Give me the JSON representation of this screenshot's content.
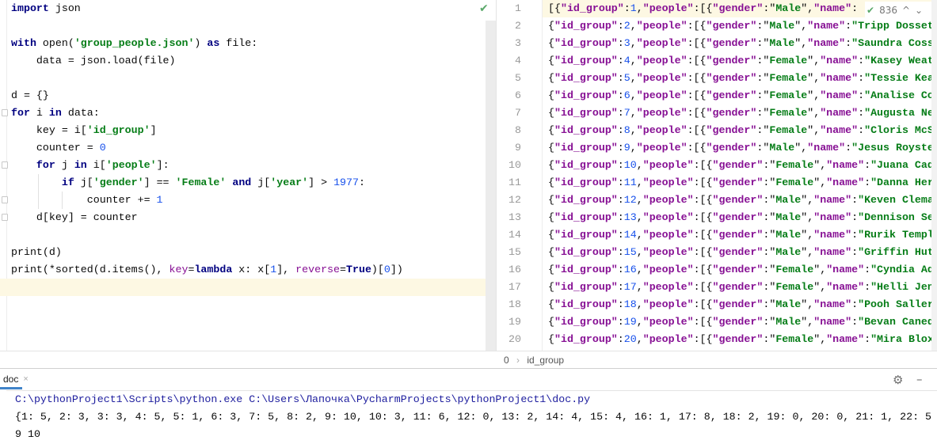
{
  "left_editor": {
    "status": "✔",
    "lines": [
      [
        [
          "import",
          "kw"
        ],
        [
          " json",
          "plain"
        ]
      ],
      [],
      [
        [
          "with",
          "kw"
        ],
        [
          " open(",
          "plain"
        ],
        [
          "'group_people.json'",
          "str"
        ],
        [
          ") ",
          "plain"
        ],
        [
          "as",
          "kw"
        ],
        [
          " file:",
          "plain"
        ]
      ],
      [
        [
          "    data = json.load(file)",
          "plain"
        ]
      ],
      [],
      [
        [
          "d = {}",
          "plain"
        ]
      ],
      [
        [
          "for",
          "kw"
        ],
        [
          " i ",
          "plain"
        ],
        [
          "in",
          "kw"
        ],
        [
          " data:",
          "plain"
        ]
      ],
      [
        [
          "    key = i[",
          "plain"
        ],
        [
          "'id_group'",
          "str"
        ],
        [
          "]",
          "plain"
        ]
      ],
      [
        [
          "    counter = ",
          "plain"
        ],
        [
          "0",
          "num"
        ]
      ],
      [
        [
          "    ",
          "plain"
        ],
        [
          "for",
          "kw"
        ],
        [
          " j ",
          "plain"
        ],
        [
          "in",
          "kw"
        ],
        [
          " i[",
          "plain"
        ],
        [
          "'people'",
          "str"
        ],
        [
          "]:",
          "plain"
        ]
      ],
      [
        [
          "        ",
          "plain"
        ],
        [
          "if",
          "kw"
        ],
        [
          " j[",
          "plain"
        ],
        [
          "'gender'",
          "str"
        ],
        [
          "] == ",
          "plain"
        ],
        [
          "'Female'",
          "str"
        ],
        [
          " ",
          "plain"
        ],
        [
          "and",
          "kw"
        ],
        [
          " j[",
          "plain"
        ],
        [
          "'year'",
          "str"
        ],
        [
          "] > ",
          "plain"
        ],
        [
          "1977",
          "num"
        ],
        [
          ":",
          "plain"
        ]
      ],
      [
        [
          "            counter += ",
          "plain"
        ],
        [
          "1",
          "num"
        ]
      ],
      [
        [
          "    d[key] = counter",
          "plain"
        ]
      ],
      [],
      [
        [
          "print(d)",
          "plain"
        ]
      ],
      [
        [
          "print(*sorted(d.items(), ",
          "plain"
        ],
        [
          "key",
          "param"
        ],
        [
          "=",
          "plain"
        ],
        [
          "lambda",
          "kw"
        ],
        [
          " x: x[",
          "plain"
        ],
        [
          "1",
          "num"
        ],
        [
          "], ",
          "plain"
        ],
        [
          "reverse",
          "param"
        ],
        [
          "=",
          "plain"
        ],
        [
          "True",
          "kw"
        ],
        [
          ")[",
          "plain"
        ],
        [
          "0",
          "num"
        ],
        [
          "])",
          "plain"
        ]
      ]
    ]
  },
  "right_editor": {
    "rows": [
      {
        "n": "1",
        "prefix": "[{",
        "id": "1",
        "gender": "Male",
        "name": ""
      },
      {
        "n": "2",
        "prefix": "{",
        "id": "2",
        "gender": "Male",
        "name": "Tripp Dosset"
      },
      {
        "n": "3",
        "prefix": "{",
        "id": "3",
        "gender": "Male",
        "name": "Saundra Coss"
      },
      {
        "n": "4",
        "prefix": "{",
        "id": "4",
        "gender": "Female",
        "name": "Kasey Weat"
      },
      {
        "n": "5",
        "prefix": "{",
        "id": "5",
        "gender": "Female",
        "name": "Tessie Kea"
      },
      {
        "n": "6",
        "prefix": "{",
        "id": "6",
        "gender": "Female",
        "name": "Analise Co"
      },
      {
        "n": "7",
        "prefix": "{",
        "id": "7",
        "gender": "Female",
        "name": "Augusta Ne"
      },
      {
        "n": "8",
        "prefix": "{",
        "id": "8",
        "gender": "Female",
        "name": "Cloris McS"
      },
      {
        "n": "9",
        "prefix": "{",
        "id": "9",
        "gender": "Male",
        "name": "Jesus Royste"
      },
      {
        "n": "10",
        "prefix": "{",
        "id": "10",
        "gender": "Female",
        "name": "Juana Cad"
      },
      {
        "n": "11",
        "prefix": "{",
        "id": "11",
        "gender": "Female",
        "name": "Danna Her"
      },
      {
        "n": "12",
        "prefix": "{",
        "id": "12",
        "gender": "Male",
        "name": "Keven Clema"
      },
      {
        "n": "13",
        "prefix": "{",
        "id": "13",
        "gender": "Male",
        "name": "Dennison Se"
      },
      {
        "n": "14",
        "prefix": "{",
        "id": "14",
        "gender": "Male",
        "name": "Rurik Templ"
      },
      {
        "n": "15",
        "prefix": "{",
        "id": "15",
        "gender": "Male",
        "name": "Griffin Hut"
      },
      {
        "n": "16",
        "prefix": "{",
        "id": "16",
        "gender": "Female",
        "name": "Cyndia Ad"
      },
      {
        "n": "17",
        "prefix": "{",
        "id": "17",
        "gender": "Female",
        "name": "Helli Jen"
      },
      {
        "n": "18",
        "prefix": "{",
        "id": "18",
        "gender": "Male",
        "name": "Pooh Saller"
      },
      {
        "n": "19",
        "prefix": "{",
        "id": "19",
        "gender": "Male",
        "name": "Bevan Caned"
      },
      {
        "n": "20",
        "prefix": "{",
        "id": "20",
        "gender": "Female",
        "name": "Mira Blox"
      }
    ],
    "key_id": "\"id_group\"",
    "key_people": "\"people\"",
    "key_gender": "\"gender\"",
    "key_name": "\"name\"",
    "widget": {
      "check": "✔",
      "count": "836",
      "up": "^",
      "down": "⌄"
    }
  },
  "breadcrumb": {
    "root": "0",
    "sep": "›",
    "item": "id_group"
  },
  "run_panel": {
    "tab_label": "doc",
    "tab_close": "×",
    "gear": "⚙",
    "minimize": "–",
    "output": [
      "C:\\pythonProject1\\Scripts\\python.exe C:\\Users\\Лапочка\\PycharmProjects\\pythonProject1\\doc.py",
      "{1: 5, 2: 3, 3: 3, 4: 5, 5: 1, 6: 3, 7: 5, 8: 2, 9: 10, 10: 3, 11: 6, 12: 0, 13: 2, 14: 4, 15: 4, 16: 1, 17: 8, 18: 2, 19: 0, 20: 0, 21: 1, 22: 5",
      "9 10"
    ]
  }
}
